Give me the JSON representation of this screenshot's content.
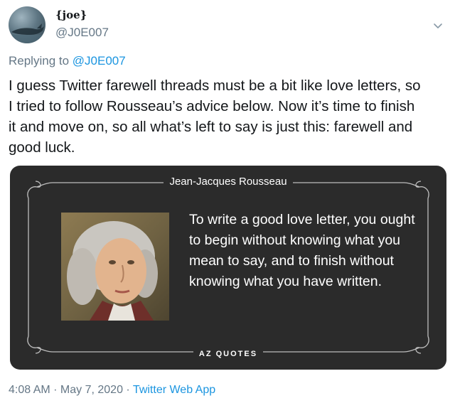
{
  "author": {
    "display_name": "{joe}",
    "handle": "@J0E007",
    "avatar_icon": "whale-avatar"
  },
  "menu": {
    "icon": "chevron-down-icon"
  },
  "reply": {
    "prefix": "Replying to",
    "mention": "@J0E007"
  },
  "tweet": {
    "text": "I guess Twitter farewell threads must be a bit like love letters, so\nI tried to follow Rousseau’s advice below. Now it’s time to finish\nit and move on, so all what’s left to say is just this: farewell and\ngood luck."
  },
  "quote_card": {
    "author": "Jean-Jacques Rousseau",
    "quote": "To write a good love letter, you ought to begin without knowing what you mean to say, and to finish without knowing what you have written.",
    "brand": "AZ QUOTES",
    "background_color": "#2b2b2b"
  },
  "meta": {
    "time": "4:08 AM",
    "separator1": " · ",
    "date": "May 7, 2020",
    "separator2": " · ",
    "source": "Twitter Web App"
  },
  "colors": {
    "link": "#1b95e0",
    "secondary_text": "#657786"
  }
}
